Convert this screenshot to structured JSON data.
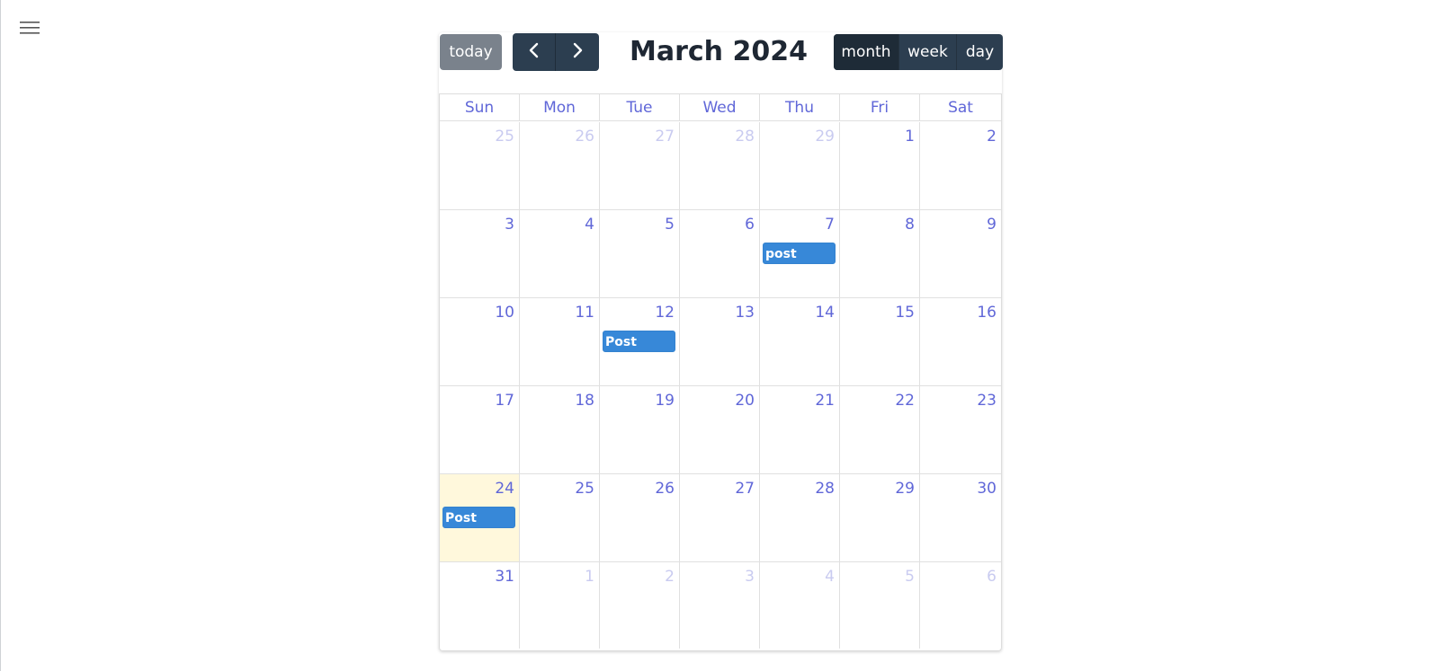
{
  "app": {
    "menu_icon": "hamburger-menu-icon"
  },
  "toolbar": {
    "today_label": "today",
    "prev_icon": "chevron-left-icon",
    "next_icon": "chevron-right-icon",
    "title": "March 2024",
    "views": [
      {
        "label": "month",
        "active": true
      },
      {
        "label": "week",
        "active": false
      },
      {
        "label": "day",
        "active": false
      }
    ]
  },
  "calendar": {
    "weekdays": [
      "Sun",
      "Mon",
      "Tue",
      "Wed",
      "Thu",
      "Fri",
      "Sat"
    ],
    "weeks": [
      [
        {
          "day": "25",
          "other": true
        },
        {
          "day": "26",
          "other": true
        },
        {
          "day": "27",
          "other": true
        },
        {
          "day": "28",
          "other": true
        },
        {
          "day": "29",
          "other": true
        },
        {
          "day": "1"
        },
        {
          "day": "2"
        }
      ],
      [
        {
          "day": "3"
        },
        {
          "day": "4"
        },
        {
          "day": "5"
        },
        {
          "day": "6"
        },
        {
          "day": "7",
          "events": [
            "post"
          ]
        },
        {
          "day": "8"
        },
        {
          "day": "9"
        }
      ],
      [
        {
          "day": "10"
        },
        {
          "day": "11"
        },
        {
          "day": "12",
          "events": [
            "Post"
          ]
        },
        {
          "day": "13"
        },
        {
          "day": "14"
        },
        {
          "day": "15"
        },
        {
          "day": "16"
        }
      ],
      [
        {
          "day": "17"
        },
        {
          "day": "18"
        },
        {
          "day": "19"
        },
        {
          "day": "20"
        },
        {
          "day": "21"
        },
        {
          "day": "22"
        },
        {
          "day": "23"
        }
      ],
      [
        {
          "day": "24",
          "today": true,
          "events": [
            "Post"
          ]
        },
        {
          "day": "25"
        },
        {
          "day": "26"
        },
        {
          "day": "27"
        },
        {
          "day": "28"
        },
        {
          "day": "29"
        },
        {
          "day": "30"
        }
      ],
      [
        {
          "day": "31"
        },
        {
          "day": "1",
          "other": true
        },
        {
          "day": "2",
          "other": true
        },
        {
          "day": "3",
          "other": true
        },
        {
          "day": "4",
          "other": true
        },
        {
          "day": "5",
          "other": true
        },
        {
          "day": "6",
          "other": true
        }
      ]
    ]
  },
  "colors": {
    "day_number": "#6067d8",
    "other_month_day": "#c9cbf0",
    "today_background": "#fff8dc",
    "event_background": "#3788d8",
    "today_button": "#7a828c",
    "toolbar_button": "#2c3e50",
    "active_view_button": "#1e2b37"
  }
}
